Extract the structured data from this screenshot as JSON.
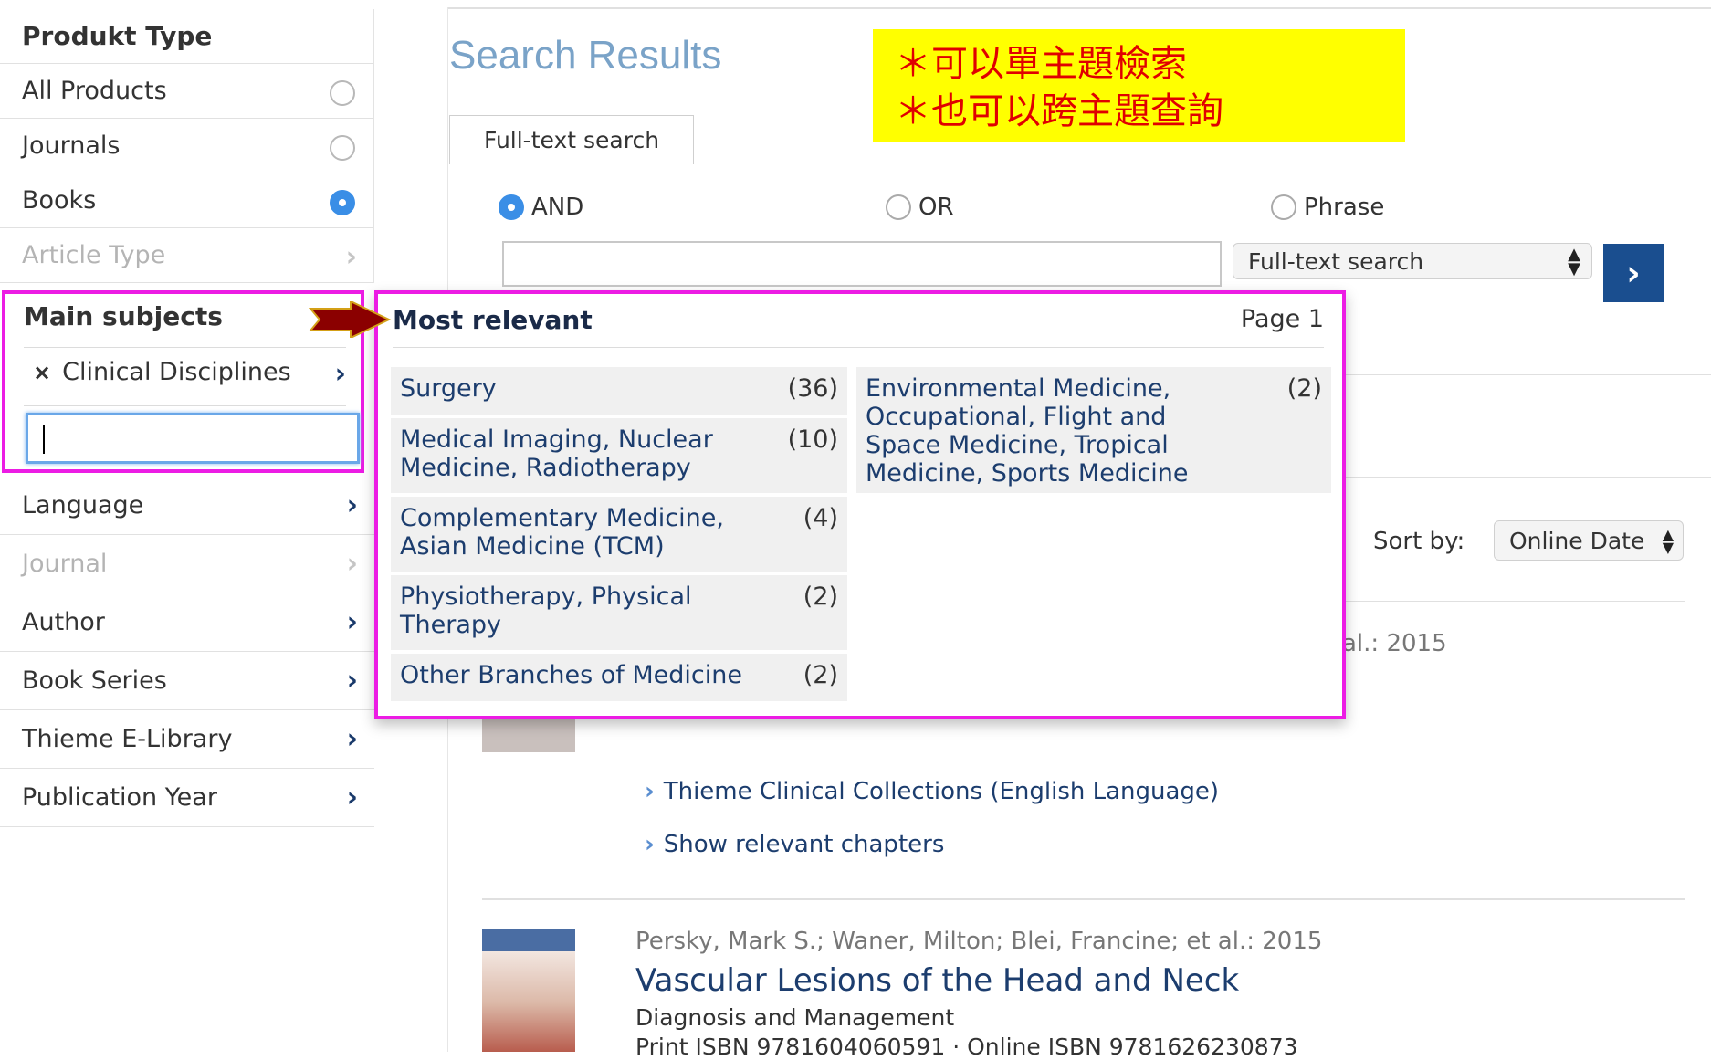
{
  "sidebar": {
    "product_type": {
      "heading": "Produkt Type",
      "options": [
        {
          "label": "All Products",
          "checked": false
        },
        {
          "label": "Journals",
          "checked": false
        },
        {
          "label": "Books",
          "checked": true
        }
      ]
    },
    "article_type": "Article Type",
    "main_subjects": {
      "heading": "Main subjects",
      "chip": "Clinical Disciplines",
      "chip_remove": "×",
      "filter_value": ""
    },
    "facets": [
      {
        "label": "Language",
        "enabled": true
      },
      {
        "label": "Journal",
        "enabled": false
      },
      {
        "label": "Author",
        "enabled": true
      },
      {
        "label": "Book Series",
        "enabled": true
      },
      {
        "label": "Thieme E-Library",
        "enabled": true
      },
      {
        "label": "Publication Year",
        "enabled": true
      }
    ],
    "chevron": "›"
  },
  "main": {
    "title": "Search Results",
    "note_lines": [
      "＊可以單主題檢索",
      "＊也可以跨主題查詢"
    ],
    "tab_label": "Full-text search",
    "operators": [
      {
        "label": "AND",
        "checked": true
      },
      {
        "label": "OR",
        "checked": false
      },
      {
        "label": "Phrase",
        "checked": false
      }
    ],
    "search_query": "",
    "search_scope": "Full-text search",
    "go_label": "›",
    "sort_label": "Sort by:",
    "sort_value": "Online Date",
    "partial_meta": "al.: 2015",
    "links": [
      {
        "label": "Thieme Clinical Collections (English Language)",
        "chev": "›"
      },
      {
        "label": "Show relevant chapters",
        "chev": "›"
      }
    ],
    "result": {
      "authors": "Persky, Mark S.; Waner, Milton; Blei, Francine; et al.: 2015",
      "title": "Vascular Lesions of the Head and Neck",
      "subtitle": "Diagnosis and Management",
      "isbn": "Print ISBN 9781604060591 · Online ISBN 9781626230873"
    }
  },
  "dropdown": {
    "title": "Most relevant",
    "page": "Page 1",
    "items_left": [
      {
        "label": "Surgery",
        "count": "(36)"
      },
      {
        "label": "Medical Imaging, Nuclear Medicine, Radiotherapy",
        "count": "(10)"
      },
      {
        "label": "Complementary Medicine, Asian Medicine (TCM)",
        "count": "(4)"
      },
      {
        "label": "Physiotherapy, Physical Therapy",
        "count": "(2)"
      },
      {
        "label": "Other Branches of Medicine",
        "count": "(2)"
      }
    ],
    "items_right": [
      {
        "label": "Environmental Medicine, Occupational, Flight and Space Medicine, Tropical Medicine, Sports Medicine",
        "count": "(2)"
      }
    ]
  },
  "colors": {
    "highlight": "#ec1ce4",
    "note_bg": "#ffff00",
    "note_text": "#e00000",
    "arrow": "#8b0000",
    "accent": "#1a4e8f"
  }
}
